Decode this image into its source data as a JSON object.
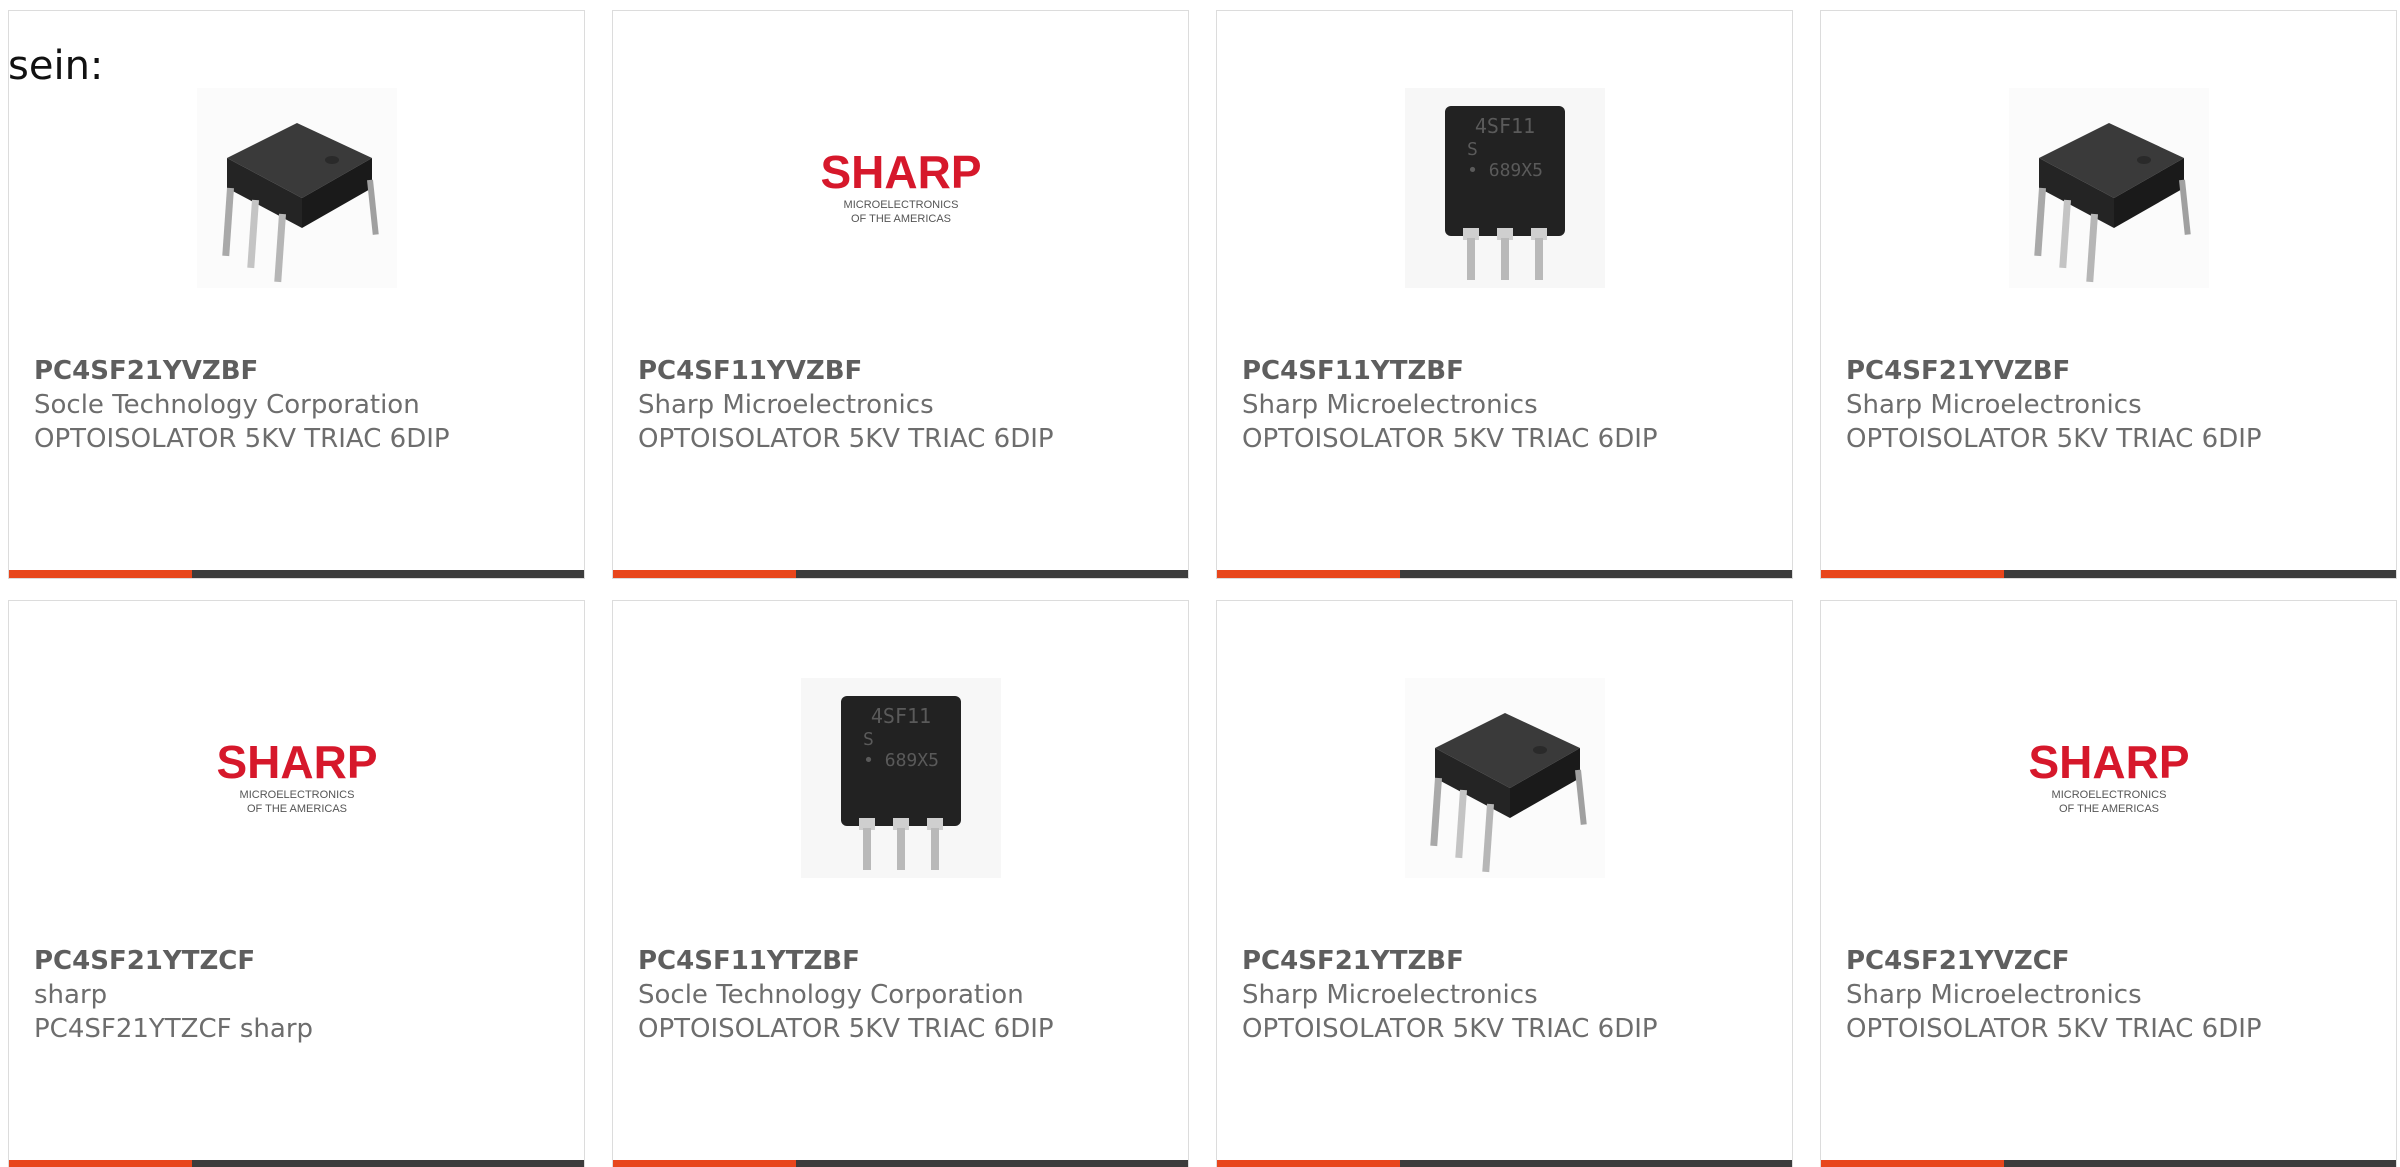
{
  "intro": {
    "text": "sein:"
  },
  "colors": {
    "accent": "#e8461c",
    "bar": "#3c3c3c",
    "sharp_red": "#d6182b"
  },
  "products": [
    {
      "part": "PC4SF21YVZBF",
      "maker": "Socle Technology Corporation",
      "desc": "OPTOISOLATOR 5KV TRIAC 6DIP",
      "image": "dip6-angled"
    },
    {
      "part": "PC4SF11YVZBF",
      "maker": "Sharp Microelectronics",
      "desc": "OPTOISOLATOR 5KV TRIAC 6DIP",
      "image": "sharp-logo"
    },
    {
      "part": "PC4SF11YTZBF",
      "maker": "Sharp Microelectronics",
      "desc": "OPTOISOLATOR 5KV TRIAC 6DIP",
      "image": "dip6-front"
    },
    {
      "part": "PC4SF21YVZBF",
      "maker": "Sharp Microelectronics",
      "desc": "OPTOISOLATOR 5KV TRIAC 6DIP",
      "image": "dip6-angled"
    },
    {
      "part": "PC4SF21YTZCF",
      "maker": "sharp",
      "desc": "PC4SF21YTZCF sharp",
      "image": "sharp-logo"
    },
    {
      "part": "PC4SF11YTZBF",
      "maker": "Socle Technology Corporation",
      "desc": "OPTOISOLATOR 5KV TRIAC 6DIP",
      "image": "dip6-front"
    },
    {
      "part": "PC4SF21YTZBF",
      "maker": "Sharp Microelectronics",
      "desc": "OPTOISOLATOR 5KV TRIAC 6DIP",
      "image": "dip6-angled"
    },
    {
      "part": "PC4SF21YVZCF",
      "maker": "Sharp Microelectronics",
      "desc": "OPTOISOLATOR 5KV TRIAC 6DIP",
      "image": "sharp-logo"
    }
  ],
  "logo": {
    "word": "SHARP",
    "line1": "MICROELECTRONICS",
    "line2": "OF THE AMERICAS"
  },
  "chip": {
    "marking_line1": "4SF11",
    "marking_line2": "S",
    "marking_line3": "• 689X5"
  }
}
